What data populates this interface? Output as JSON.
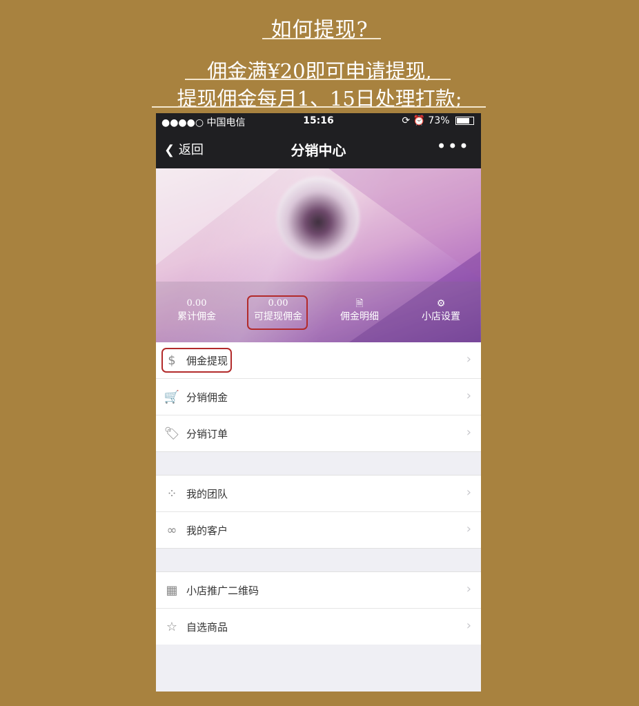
{
  "banner": {
    "title": "如何提现?",
    "line1": "佣金满¥20即可申请提现,",
    "line2": "提现佣金每月1、15日处理打款;"
  },
  "statusbar": {
    "carrier": "●●●●○ 中国电信",
    "time": "15:16",
    "battery": "73%"
  },
  "nav": {
    "back_label": "返回",
    "title": "分销中心",
    "more_label": "•••"
  },
  "stats": [
    {
      "value": "0.00",
      "label": "累计佣金"
    },
    {
      "value": "0.00",
      "label": "可提现佣金"
    },
    {
      "icon": "document-icon",
      "label": "佣金明细"
    },
    {
      "icon": "gear-icon",
      "label": "小店设置"
    }
  ],
  "menu": {
    "group1": [
      {
        "icon": "dollar-circle-icon",
        "label": "佣金提现"
      },
      {
        "icon": "cart-icon",
        "label": "分销佣金"
      },
      {
        "icon": "tag-icon",
        "label": "分销订单"
      }
    ],
    "group2": [
      {
        "icon": "dots-grid-icon",
        "label": "我的团队"
      },
      {
        "icon": "share-icon",
        "label": "我的客户"
      }
    ],
    "group3": [
      {
        "icon": "qr-grid-icon",
        "label": "小店推广二维码"
      },
      {
        "icon": "star-icon",
        "label": "自选商品"
      }
    ]
  },
  "colors": {
    "background": "#a8823f",
    "navbar": "#1f1f22",
    "highlight": "#b22a2a"
  }
}
